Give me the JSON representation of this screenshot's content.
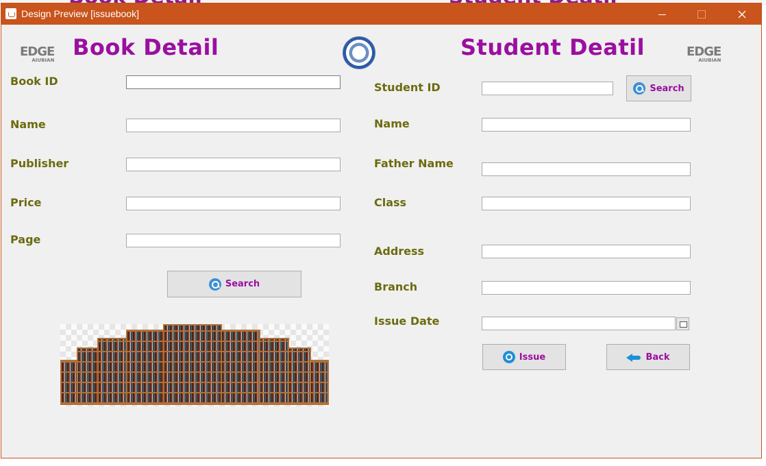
{
  "window": {
    "title": "Design Preview [issuebook]",
    "minimize": "minimize",
    "maximize": "maximize",
    "close": "close"
  },
  "background": {
    "ghost_left": "Book Detail",
    "ghost_right": "Student Deatil"
  },
  "logo": {
    "name": "EDGE",
    "sub": "AIUBIAN"
  },
  "book": {
    "heading": "Book Detail",
    "labels": {
      "book_id": "Book ID",
      "name": "Name",
      "publisher": "Publisher",
      "price": "Price",
      "page": "Page"
    },
    "values": {
      "book_id": "",
      "name": "",
      "publisher": "",
      "price": "",
      "page": ""
    },
    "search_button": "Search"
  },
  "student": {
    "heading": "Student Deatil",
    "labels": {
      "student_id": "Student ID",
      "name": "Name",
      "father_name": "Father Name",
      "class": "Class",
      "address": "Address",
      "branch": "Branch",
      "issue_date": "Issue Date"
    },
    "values": {
      "student_id": "",
      "name": "",
      "father_name": "",
      "class": "",
      "address": "",
      "branch": "",
      "issue_date": ""
    },
    "search_button": "Search",
    "issue_button": "Issue",
    "back_button": "Back"
  },
  "icons": {
    "search": "search-icon",
    "issue": "issue-icon",
    "back": "back-arrow-icon",
    "calendar": "calendar-icon"
  },
  "colors": {
    "titlebar": "#c9541c",
    "heading": "#9a0fa0",
    "label": "#6b6b10"
  }
}
